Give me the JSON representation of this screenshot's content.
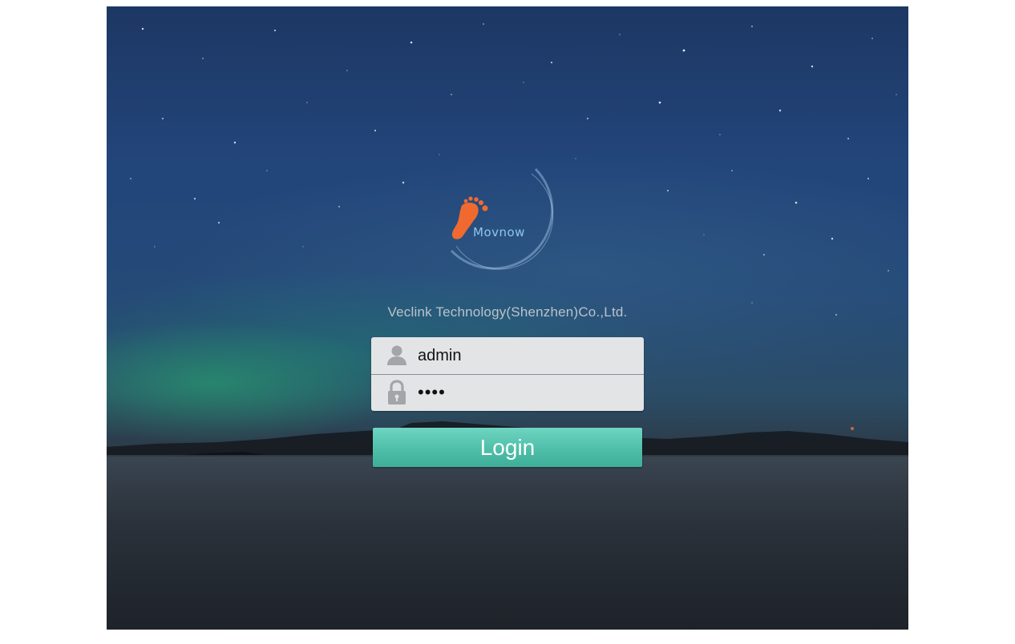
{
  "brand": {
    "logo_text": "MOVNOW",
    "company": "Veclink Technology(Shenzhen)Co.,Ltd."
  },
  "login_form": {
    "username": {
      "value": "admin",
      "icon": "user-icon"
    },
    "password": {
      "value": "test",
      "icon": "lock-icon"
    },
    "submit_label": "Login"
  },
  "colors": {
    "logo_orange": "#f06a30",
    "logo_text_blue": "#8ec7ea",
    "login_button": "#52c2ab",
    "field_background": "#e3e4e6"
  }
}
